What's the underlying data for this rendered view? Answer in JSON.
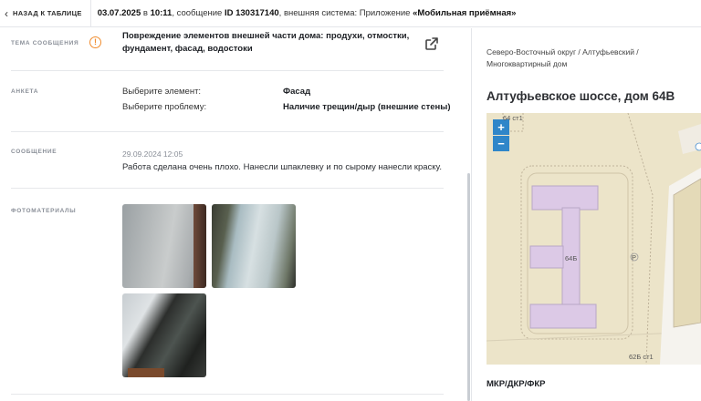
{
  "topbar": {
    "back_label": "НАЗАД К ТАБЛИЦЕ",
    "date": "03.07.2025",
    "time_prefix": "в",
    "time": "10:11",
    "message_prefix": ", сообщение",
    "id_label": "ID 130317140",
    "system_prefix": ", внешняя система: Приложение",
    "system_name": "«Мобильная приёмная»"
  },
  "sections": {
    "topic": {
      "label": "ТЕМА СООБЩЕНИЯ",
      "text": "Повреждение элементов внешней части дома: продухи, отмостки, фундамент, фасад, водостоки"
    },
    "form": {
      "label": "АНКЕТА",
      "rows": [
        {
          "key": "Выберите элемент:",
          "value": "Фасад"
        },
        {
          "key": "Выберите проблему:",
          "value": "Наличие трещин/дыр (внешние стены)"
        }
      ]
    },
    "message": {
      "label": "СООБЩЕНИЕ",
      "date": "29.09.2024 12:05",
      "text": "Работа сделана очень плохо. Нанесли шпаклевку и по сырому нанесли краску."
    },
    "photos": {
      "label": "ФОТОМАТЕРИАЛЫ"
    }
  },
  "right": {
    "breadcrumb": "Северо-Восточный округ / Алтуфьевский / Многоквартирный дом",
    "address": "Алтуфьевское шоссе, дом 64В",
    "map": {
      "labels": {
        "top": "64 ст1",
        "building": "64Б",
        "bottom": "62Б ст1",
        "poi": "Р"
      },
      "zoom_in": "+",
      "zoom_out": "−"
    },
    "footer_title": "МКР/ДКР/ФКР"
  },
  "colors": {
    "accent_warn": "#f08c2e",
    "map_bg": "#ece4c9",
    "building": "#dcc9e6",
    "zoom": "#2f86c9"
  }
}
